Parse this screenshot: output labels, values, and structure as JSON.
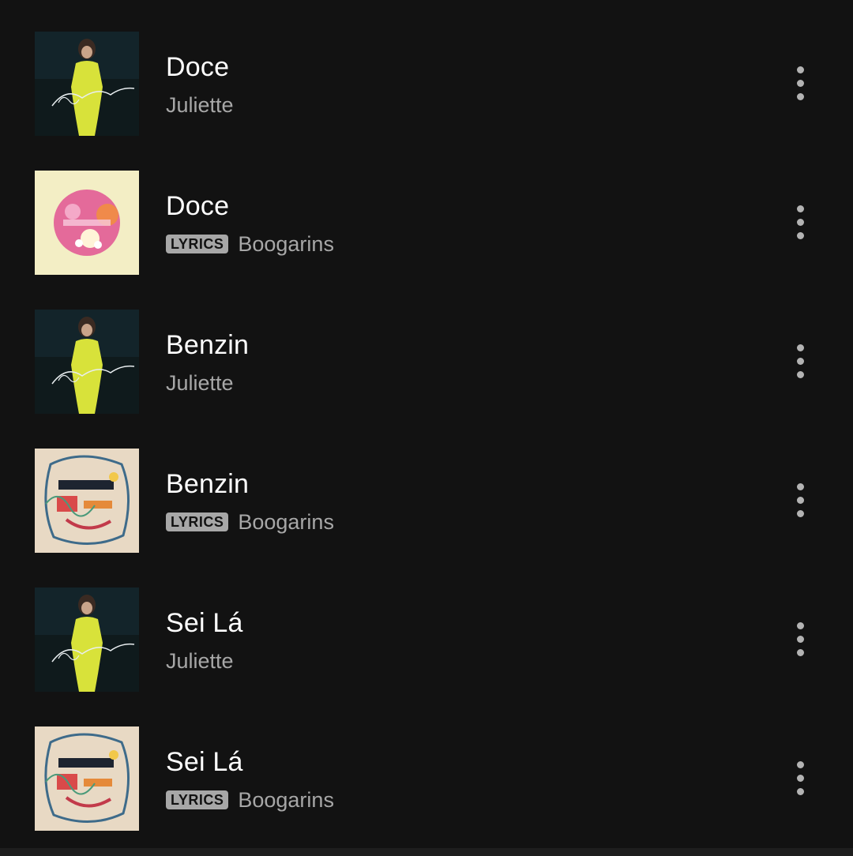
{
  "tracks": [
    {
      "title": "Doce",
      "artist": "Juliette",
      "has_lyrics": false,
      "cover": "juliette-album-cover",
      "badge": ""
    },
    {
      "title": "Doce",
      "artist": "Boogarins",
      "has_lyrics": true,
      "cover": "boogarins-doce-cover",
      "badge": "LYRICS"
    },
    {
      "title": "Benzin",
      "artist": "Juliette",
      "has_lyrics": false,
      "cover": "juliette-album-cover",
      "badge": ""
    },
    {
      "title": "Benzin",
      "artist": "Boogarins",
      "has_lyrics": true,
      "cover": "boogarins-painting-cover",
      "badge": "LYRICS"
    },
    {
      "title": "Sei Lá",
      "artist": "Juliette",
      "has_lyrics": false,
      "cover": "juliette-album-cover",
      "badge": ""
    },
    {
      "title": "Sei Lá",
      "artist": "Boogarins",
      "has_lyrics": true,
      "cover": "boogarins-painting-cover",
      "badge": "LYRICS"
    }
  ],
  "icons": {
    "more": "more-vertical-icon"
  },
  "colors": {
    "background": "#121212",
    "title": "#ffffff",
    "secondary": "#a7a7a7"
  }
}
